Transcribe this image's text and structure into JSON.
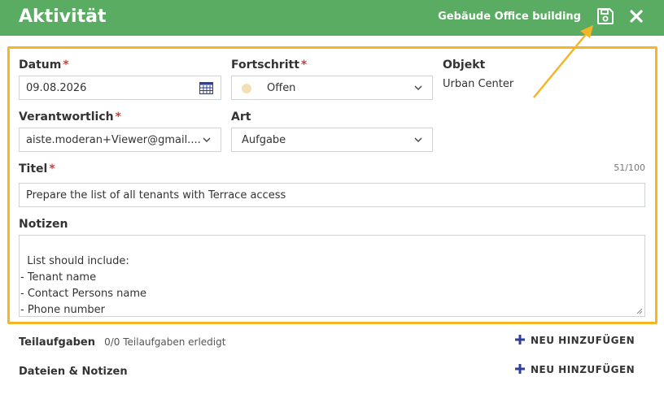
{
  "header": {
    "title": "Aktivität",
    "building_prefix": "Gebäude",
    "building_name": "Office building",
    "save_icon": "save-icon",
    "close_icon": "close-icon"
  },
  "colors": {
    "header_bg": "#5bac63",
    "highlight": "#f5b525",
    "required": "#d23b3b",
    "add_icon": "#2d3e9c",
    "status_open": "#f3dfb3"
  },
  "form": {
    "datum": {
      "label": "Datum",
      "required": "*",
      "value": "09.08.2026"
    },
    "fortschritt": {
      "label": "Fortschritt",
      "required": "*",
      "value": "Offen"
    },
    "objekt": {
      "label": "Objekt",
      "value": "Urban Center"
    },
    "verantwortlich": {
      "label": "Verantwortlich",
      "required": "*",
      "value": "aiste.moderan+Viewer@gmail...."
    },
    "art": {
      "label": "Art",
      "value": "Aufgabe"
    },
    "titel": {
      "label": "Titel",
      "required": "*",
      "value": "Prepare the list of all tenants with Terrace access",
      "counter": "51/100"
    },
    "notizen": {
      "label": "Notizen",
      "value": "List should include:\n- Tenant name\n- Contact Persons name\n- Phone number\n- Email address"
    }
  },
  "sections": {
    "teilaufgaben": {
      "title": "Teilaufgaben",
      "status": "0/0 Teilaufgaben erledigt",
      "add_label": "NEU HINZUFÜGEN"
    },
    "dateien": {
      "title": "Dateien & Notizen",
      "add_label": "NEU HINZUFÜGEN"
    }
  }
}
